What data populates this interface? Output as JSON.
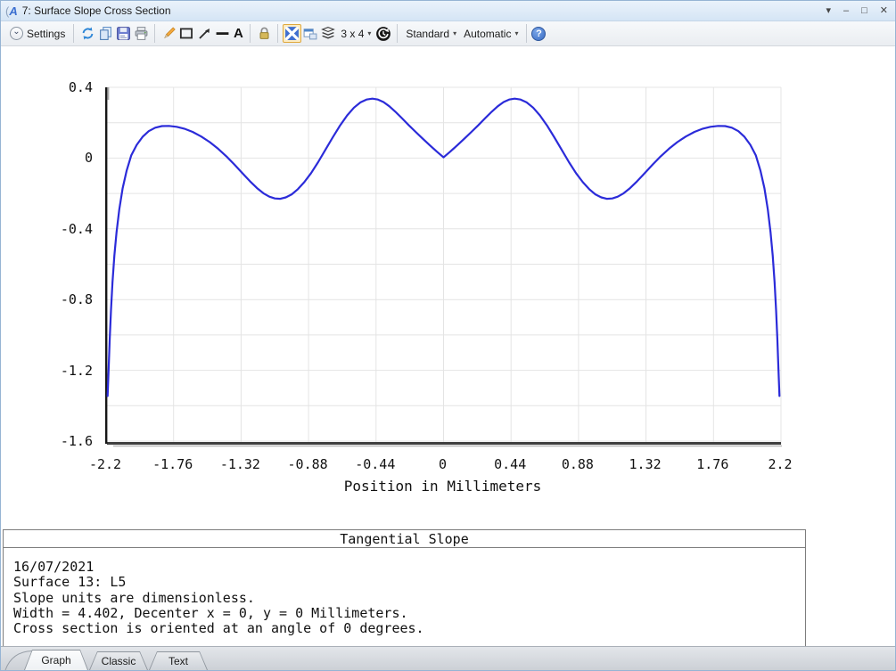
{
  "window": {
    "title": "7: Surface Slope Cross Section",
    "controls": {
      "shade": "▾",
      "minimize": "–",
      "maximize": "□",
      "close": "✕"
    }
  },
  "toolbar": {
    "settings_label": "Settings",
    "grid_size_label": "3 x 4",
    "standard_label": "Standard",
    "automatic_label": "Automatic",
    "icon_names": [
      "refresh",
      "copy",
      "save",
      "print",
      "annotate-pencil",
      "annotate-rectangle",
      "annotate-arrow",
      "annotate-line",
      "annotate-text",
      "lock",
      "scale-to-fit",
      "copy-to-window",
      "overlay-series",
      "auto-apply",
      "help"
    ]
  },
  "icons": {
    "caret": "▾",
    "settings_chevron": "⌄",
    "help_glyph": "?"
  },
  "chart_data": {
    "type": "line",
    "title": "Tangential Slope",
    "xlabel": "Position in Millimeters",
    "ylabel": "",
    "xlim": [
      -2.2,
      2.2
    ],
    "ylim": [
      -1.6,
      0.4
    ],
    "grid": true,
    "legend": false,
    "x_ticks": [
      -2.2,
      -1.76,
      -1.32,
      -0.88,
      -0.44,
      0,
      0.44,
      0.88,
      1.32,
      1.76,
      2.2
    ],
    "x_tick_labels": [
      "-2.2",
      "-1.76",
      "-1.32",
      "-0.88",
      "-0.44",
      "0",
      "0.44",
      "0.88",
      "1.32",
      "1.76",
      "2.2"
    ],
    "y_major_ticks": [
      0.4,
      0,
      -0.4,
      -0.8,
      -1.2,
      -1.6
    ],
    "y_major_tick_labels": [
      "0.4",
      "0",
      "-0.4",
      "-0.8",
      "-1.2",
      "-1.6"
    ],
    "y_grid_step": 0.2,
    "line_color": "#2b2bd9",
    "grid_color": "#e4e4e4",
    "series": [
      {
        "name": "Tangential Slope",
        "points": [
          [
            -2.19,
            -1.345
          ],
          [
            -2.184,
            -1.2
          ],
          [
            -2.176,
            -1.02
          ],
          [
            -2.168,
            -0.86
          ],
          [
            -2.158,
            -0.7
          ],
          [
            -2.146,
            -0.55
          ],
          [
            -2.132,
            -0.42
          ],
          [
            -2.114,
            -0.29
          ],
          [
            -2.092,
            -0.17
          ],
          [
            -2.066,
            -0.07
          ],
          [
            -2.036,
            0.015
          ],
          [
            -2.0,
            0.075
          ],
          [
            -1.962,
            0.12
          ],
          [
            -1.922,
            0.152
          ],
          [
            -1.88,
            0.172
          ],
          [
            -1.836,
            0.181
          ],
          [
            -1.79,
            0.182
          ],
          [
            -1.74,
            0.177
          ],
          [
            -1.69,
            0.166
          ],
          [
            -1.636,
            0.148
          ],
          [
            -1.58,
            0.122
          ],
          [
            -1.524,
            0.09
          ],
          [
            -1.47,
            0.053
          ],
          [
            -1.416,
            0.01
          ],
          [
            -1.364,
            -0.036
          ],
          [
            -1.312,
            -0.085
          ],
          [
            -1.262,
            -0.131
          ],
          [
            -1.216,
            -0.17
          ],
          [
            -1.174,
            -0.199
          ],
          [
            -1.136,
            -0.218
          ],
          [
            -1.1,
            -0.228
          ],
          [
            -1.064,
            -0.23
          ],
          [
            -1.028,
            -0.222
          ],
          [
            -0.99,
            -0.205
          ],
          [
            -0.95,
            -0.176
          ],
          [
            -0.908,
            -0.136
          ],
          [
            -0.864,
            -0.085
          ],
          [
            -0.818,
            -0.023
          ],
          [
            -0.77,
            0.047
          ],
          [
            -0.722,
            0.118
          ],
          [
            -0.674,
            0.185
          ],
          [
            -0.628,
            0.242
          ],
          [
            -0.584,
            0.285
          ],
          [
            -0.542,
            0.315
          ],
          [
            -0.502,
            0.331
          ],
          [
            -0.464,
            0.336
          ],
          [
            -0.428,
            0.331
          ],
          [
            -0.392,
            0.317
          ],
          [
            -0.354,
            0.293
          ],
          [
            -0.314,
            0.262
          ],
          [
            -0.272,
            0.226
          ],
          [
            -0.228,
            0.187
          ],
          [
            -0.182,
            0.148
          ],
          [
            -0.136,
            0.11
          ],
          [
            -0.09,
            0.073
          ],
          [
            -0.044,
            0.037
          ],
          [
            0.0,
            0.004
          ],
          [
            0.044,
            0.037
          ],
          [
            0.09,
            0.073
          ],
          [
            0.136,
            0.11
          ],
          [
            0.182,
            0.148
          ],
          [
            0.228,
            0.187
          ],
          [
            0.272,
            0.226
          ],
          [
            0.314,
            0.262
          ],
          [
            0.354,
            0.293
          ],
          [
            0.392,
            0.317
          ],
          [
            0.428,
            0.331
          ],
          [
            0.464,
            0.336
          ],
          [
            0.502,
            0.331
          ],
          [
            0.542,
            0.315
          ],
          [
            0.584,
            0.285
          ],
          [
            0.628,
            0.242
          ],
          [
            0.674,
            0.185
          ],
          [
            0.722,
            0.118
          ],
          [
            0.77,
            0.047
          ],
          [
            0.818,
            -0.023
          ],
          [
            0.864,
            -0.085
          ],
          [
            0.908,
            -0.136
          ],
          [
            0.95,
            -0.176
          ],
          [
            0.99,
            -0.205
          ],
          [
            1.028,
            -0.222
          ],
          [
            1.064,
            -0.23
          ],
          [
            1.1,
            -0.228
          ],
          [
            1.136,
            -0.218
          ],
          [
            1.174,
            -0.199
          ],
          [
            1.216,
            -0.17
          ],
          [
            1.262,
            -0.131
          ],
          [
            1.312,
            -0.085
          ],
          [
            1.364,
            -0.036
          ],
          [
            1.416,
            0.01
          ],
          [
            1.47,
            0.053
          ],
          [
            1.524,
            0.09
          ],
          [
            1.58,
            0.122
          ],
          [
            1.636,
            0.148
          ],
          [
            1.69,
            0.166
          ],
          [
            1.74,
            0.177
          ],
          [
            1.79,
            0.182
          ],
          [
            1.836,
            0.181
          ],
          [
            1.88,
            0.172
          ],
          [
            1.922,
            0.152
          ],
          [
            1.962,
            0.12
          ],
          [
            2.0,
            0.075
          ],
          [
            2.036,
            0.015
          ],
          [
            2.066,
            -0.07
          ],
          [
            2.092,
            -0.17
          ],
          [
            2.114,
            -0.29
          ],
          [
            2.132,
            -0.42
          ],
          [
            2.146,
            -0.55
          ],
          [
            2.158,
            -0.7
          ],
          [
            2.168,
            -0.86
          ],
          [
            2.176,
            -1.02
          ],
          [
            2.184,
            -1.2
          ],
          [
            2.19,
            -1.345
          ]
        ]
      }
    ]
  },
  "text_panel": {
    "title": "Tangential Slope",
    "lines": [
      "16/07/2021",
      "Surface 13: L5",
      "Slope units are dimensionless.",
      "Width = 4.402, Decenter x = 0, y = 0 Millimeters.",
      "Cross section is oriented at an angle of 0 degrees."
    ]
  },
  "tabs": [
    {
      "label": "Graph",
      "active": true
    },
    {
      "label": "Classic",
      "active": false
    },
    {
      "label": "Text",
      "active": false
    }
  ]
}
